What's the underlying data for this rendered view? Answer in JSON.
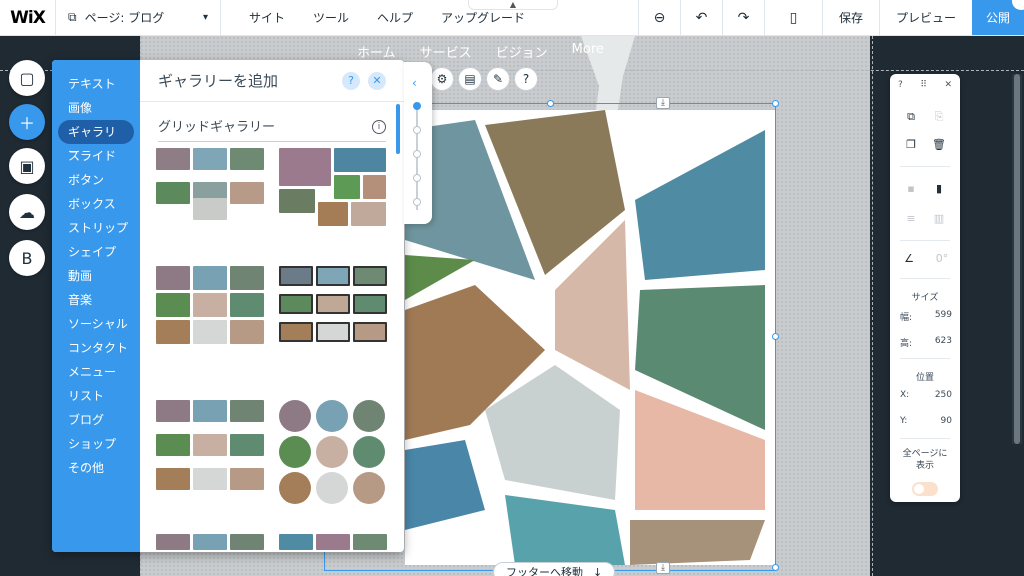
{
  "topbar": {
    "logo": "WiX",
    "page_label": "ページ: ブログ",
    "menus": [
      "サイト",
      "ツール",
      "ヘルプ",
      "アップグレード"
    ],
    "save": "保存",
    "preview": "プレビュー",
    "publish": "公開"
  },
  "site_nav": [
    "ホーム",
    "サービス",
    "ビジョン",
    "More"
  ],
  "rail": {
    "items": [
      "pages-icon",
      "add-icon",
      "store-icon",
      "upload-icon",
      "blog-icon"
    ],
    "blog_letter": "B"
  },
  "add_panel": {
    "categories": [
      "テキスト",
      "画像",
      "ギャラリー",
      "スライド",
      "ボタン",
      "ボックス",
      "ストリップ",
      "シェイプ",
      "動画",
      "音楽",
      "ソーシャル",
      "コンタクト",
      "メニュー",
      "リスト",
      "ブログ",
      "ショップ",
      "その他"
    ],
    "selected_index": 2,
    "title": "ギャラリーを追加",
    "help": "?",
    "close": "✕",
    "section_title": "グリッドギャラリー",
    "info": "i"
  },
  "inspector": {
    "help": "?",
    "close": "✕",
    "angle": "0°",
    "size_label": "サイズ",
    "width_label": "幅:",
    "width_value": "599",
    "height_label": "高:",
    "height_value": "623",
    "position_label": "位置",
    "x_label": "X:",
    "x_value": "250",
    "y_label": "Y:",
    "y_value": "90",
    "all_pages_label": "全ページに\n表示",
    "all_pages_on": false
  },
  "footer_button": "フッターへ移動",
  "colors": {
    "accent": "#3899ec",
    "dark": "#1f2a33"
  }
}
